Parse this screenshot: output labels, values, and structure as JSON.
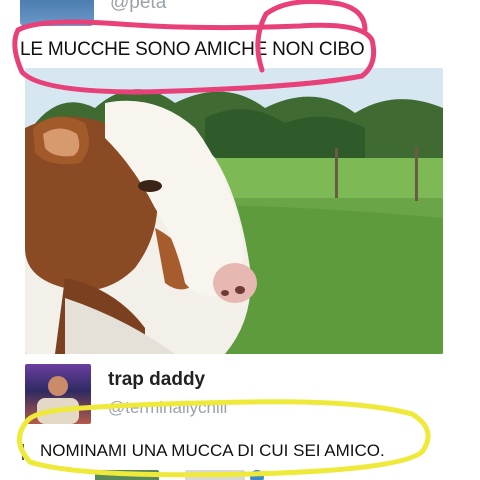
{
  "tweet1": {
    "handle": "@peta",
    "text": "LE MUCCHE SONO AMICHE NON CIBO"
  },
  "photo": {
    "subject": "cow in a green field"
  },
  "tweet2": {
    "name": "trap daddy",
    "handle": "@terminallychill",
    "text": "NOMINAMI UNA MUCCA DI CUI SEI AMICO."
  },
  "colors": {
    "pink_marker": "#e8417a",
    "yellow_marker": "#efe93a",
    "handle_gray": "#9aa3ab"
  }
}
